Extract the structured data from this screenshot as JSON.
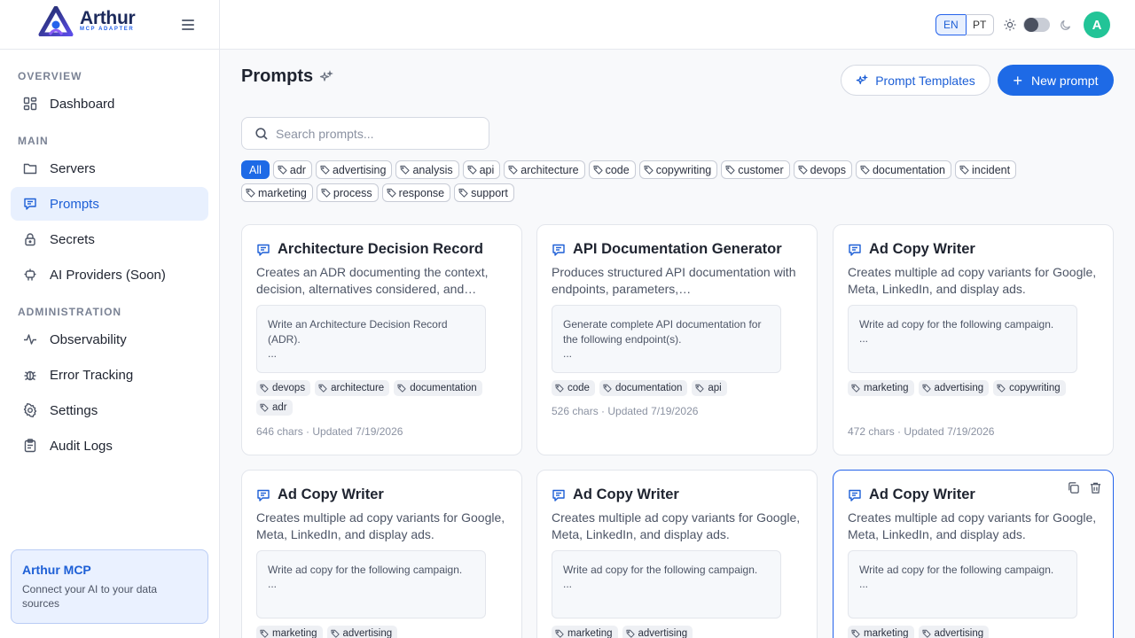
{
  "brand": {
    "name": "Arthur",
    "subtitle": "MCP ADAPTER"
  },
  "sidebar": {
    "sections": [
      {
        "label": "OVERVIEW"
      },
      {
        "label": "MAIN"
      },
      {
        "label": "ADMINISTRATION"
      }
    ],
    "items": [
      {
        "label": "Dashboard",
        "icon": "dashboard-icon"
      },
      {
        "label": "Servers",
        "icon": "folder-icon"
      },
      {
        "label": "Prompts",
        "icon": "message-icon",
        "active": true
      },
      {
        "label": "Secrets",
        "icon": "lock-icon"
      },
      {
        "label": "AI Providers (Soon)",
        "icon": "bot-icon"
      },
      {
        "label": "Observability",
        "icon": "activity-icon"
      },
      {
        "label": "Error Tracking",
        "icon": "bug-icon"
      },
      {
        "label": "Settings",
        "icon": "gear-icon"
      },
      {
        "label": "Audit Logs",
        "icon": "clipboard-icon"
      }
    ],
    "promo": {
      "title": "Arthur MCP",
      "text": "Connect your AI to your data sources"
    }
  },
  "topbar": {
    "lang_en": "EN",
    "lang_pt": "PT",
    "avatar": "A"
  },
  "main": {
    "title": "Prompts",
    "templates_button": "Prompt Templates",
    "new_button": "New prompt",
    "search_placeholder": "Search prompts...",
    "filters_row1": [
      "All",
      "adr",
      "advertising",
      "analysis",
      "api",
      "architecture",
      "code",
      "copywriting",
      "customer",
      "devops",
      "documentation",
      "incident"
    ],
    "filters_row2": [
      "marketing",
      "process",
      "response",
      "support"
    ]
  },
  "cards": [
    {
      "title": "Architecture Decision Record",
      "description": "Creates an ADR documenting the context, decision, alternatives considered, and…",
      "preview": "Write an Architecture Decision Record (ADR).",
      "ellipsis": "...",
      "tags": [
        "devops",
        "architecture",
        "documentation",
        "adr"
      ],
      "meta": "646 chars · Updated 7/19/2026"
    },
    {
      "title": "API Documentation Generator",
      "description": "Produces structured API documentation with endpoints, parameters,…",
      "preview": "Generate complete API documentation for the following endpoint(s).",
      "ellipsis": "...",
      "tags": [
        "code",
        "documentation",
        "api"
      ],
      "meta": "526 chars · Updated 7/19/2026"
    },
    {
      "title": "Ad Copy Writer",
      "description": "Creates multiple ad copy variants for Google, Meta, LinkedIn, and display ads.",
      "preview": "Write ad copy for the following campaign.",
      "ellipsis": "...",
      "tags": [
        "marketing",
        "advertising",
        "copywriting"
      ],
      "meta": "472 chars · Updated 7/19/2026"
    },
    {
      "title": "Ad Copy Writer",
      "description": "Creates multiple ad copy variants for Google, Meta, LinkedIn, and display ads.",
      "preview": "Write ad copy for the following campaign.",
      "ellipsis": "...",
      "tags": [
        "marketing",
        "advertising"
      ],
      "meta": ""
    },
    {
      "title": "Ad Copy Writer",
      "description": "Creates multiple ad copy variants for Google, Meta, LinkedIn, and display ads.",
      "preview": "Write ad copy for the following campaign.",
      "ellipsis": "...",
      "tags": [
        "marketing",
        "advertising"
      ],
      "meta": ""
    },
    {
      "title": "Ad Copy Writer",
      "description": "Creates multiple ad copy variants for Google, Meta, LinkedIn, and display ads.",
      "preview": "Write ad copy for the following campaign.",
      "ellipsis": "...",
      "tags": [
        "marketing",
        "advertising"
      ],
      "meta": "",
      "selected": true
    }
  ],
  "colors": {
    "accent": "#1e6ae6",
    "avatar": "#22c497",
    "active_bg": "#e8f0fe"
  }
}
